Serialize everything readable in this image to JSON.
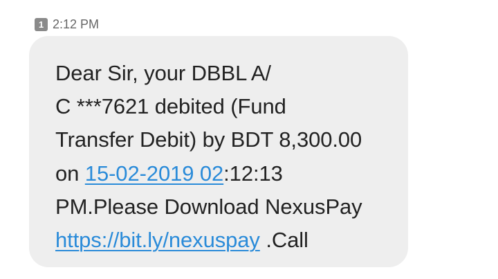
{
  "header": {
    "sim_badge": "1",
    "time": "2:12 PM"
  },
  "message": {
    "line1": "Dear Sir, your DBBL A/",
    "line2": "C ***7621 debited (Fund",
    "line3": "Transfer Debit) by BDT 8,300.00",
    "line4_prefix": "on ",
    "line4_link": "15-02-2019 02",
    "line4_suffix": ":12:13",
    "line5": "PM.Please Download NexusPay",
    "line6_link": "https://bit.ly/nexuspay",
    "line6_suffix": " .Call"
  },
  "colors": {
    "bubble_background": "#eeeeee",
    "link": "#2a8bd9",
    "text": "#222222",
    "badge": "#8a8a8a"
  }
}
